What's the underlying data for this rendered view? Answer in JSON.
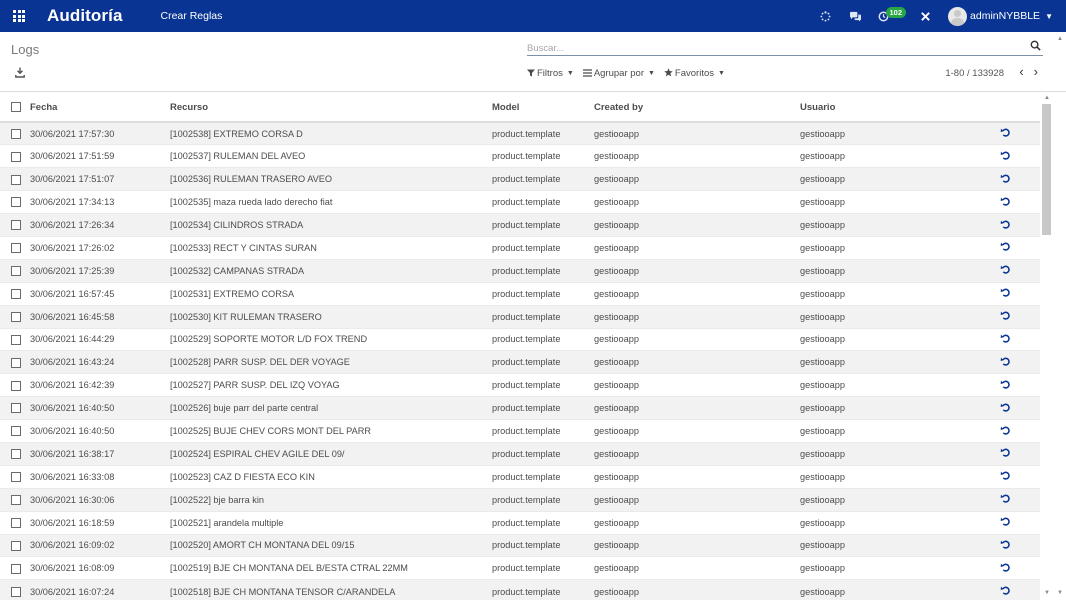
{
  "colors": {
    "navbar": "#0a3493",
    "accent": "#0a3493",
    "badge": "#28a745"
  },
  "navbar": {
    "app_title": "Auditoría",
    "menu_item": "Crear Reglas",
    "icons": [
      "activity-spinner-icon",
      "chat-icon",
      "activity-clock-icon",
      "debug-tools-icon"
    ],
    "badge_count": "102",
    "user": "adminNYBBLE"
  },
  "control_panel": {
    "breadcrumb": "Logs",
    "search_placeholder": "Buscar...",
    "filters_label": "Filtros",
    "group_by_label": "Agrupar por",
    "favorites_label": "Favoritos",
    "pager": "1-80 / 133928"
  },
  "table": {
    "headers": {
      "fecha": "Fecha",
      "recurso": "Recurso",
      "model": "Model",
      "created_by": "Created by",
      "usuario": "Usuario"
    },
    "rows": [
      {
        "fecha": "30/06/2021 17:57:30",
        "recurso": "[1002538] EXTREMO CORSA D",
        "model": "product.template",
        "created_by": "gestiooapp",
        "usuario": "gestiooapp"
      },
      {
        "fecha": "30/06/2021 17:51:59",
        "recurso": "[1002537] RULEMAN DEL AVEO",
        "model": "product.template",
        "created_by": "gestiooapp",
        "usuario": "gestiooapp"
      },
      {
        "fecha": "30/06/2021 17:51:07",
        "recurso": "[1002536] RULEMAN TRASERO AVEO",
        "model": "product.template",
        "created_by": "gestiooapp",
        "usuario": "gestiooapp"
      },
      {
        "fecha": "30/06/2021 17:34:13",
        "recurso": "[1002535] maza rueda lado derecho fiat",
        "model": "product.template",
        "created_by": "gestiooapp",
        "usuario": "gestiooapp"
      },
      {
        "fecha": "30/06/2021 17:26:34",
        "recurso": "[1002534] CILINDROS STRADA",
        "model": "product.template",
        "created_by": "gestiooapp",
        "usuario": "gestiooapp"
      },
      {
        "fecha": "30/06/2021 17:26:02",
        "recurso": "[1002533] RECT Y CINTAS SURAN",
        "model": "product.template",
        "created_by": "gestiooapp",
        "usuario": "gestiooapp"
      },
      {
        "fecha": "30/06/2021 17:25:39",
        "recurso": "[1002532] CAMPANAS STRADA",
        "model": "product.template",
        "created_by": "gestiooapp",
        "usuario": "gestiooapp"
      },
      {
        "fecha": "30/06/2021 16:57:45",
        "recurso": "[1002531] EXTREMO CORSA",
        "model": "product.template",
        "created_by": "gestiooapp",
        "usuario": "gestiooapp"
      },
      {
        "fecha": "30/06/2021 16:45:58",
        "recurso": "[1002530] KIT RULEMAN TRASERO",
        "model": "product.template",
        "created_by": "gestiooapp",
        "usuario": "gestiooapp"
      },
      {
        "fecha": "30/06/2021 16:44:29",
        "recurso": "[1002529] SOPORTE MOTOR L/D FOX TREND",
        "model": "product.template",
        "created_by": "gestiooapp",
        "usuario": "gestiooapp"
      },
      {
        "fecha": "30/06/2021 16:43:24",
        "recurso": "[1002528] PARR SUSP. DEL DER VOYAGE",
        "model": "product.template",
        "created_by": "gestiooapp",
        "usuario": "gestiooapp"
      },
      {
        "fecha": "30/06/2021 16:42:39",
        "recurso": "[1002527] PARR SUSP. DEL IZQ VOYAG",
        "model": "product.template",
        "created_by": "gestiooapp",
        "usuario": "gestiooapp"
      },
      {
        "fecha": "30/06/2021 16:40:50",
        "recurso": "[1002526] buje parr del parte central",
        "model": "product.template",
        "created_by": "gestiooapp",
        "usuario": "gestiooapp"
      },
      {
        "fecha": "30/06/2021 16:40:50",
        "recurso": "[1002525] BUJE CHEV CORS MONT DEL PARR",
        "model": "product.template",
        "created_by": "gestiooapp",
        "usuario": "gestiooapp"
      },
      {
        "fecha": "30/06/2021 16:38:17",
        "recurso": "[1002524] ESPIRAL CHEV AGILE DEL 09/",
        "model": "product.template",
        "created_by": "gestiooapp",
        "usuario": "gestiooapp"
      },
      {
        "fecha": "30/06/2021 16:33:08",
        "recurso": "[1002523] CAZ D FIESTA ECO KIN",
        "model": "product.template",
        "created_by": "gestiooapp",
        "usuario": "gestiooapp"
      },
      {
        "fecha": "30/06/2021 16:30:06",
        "recurso": "[1002522] bje barra kin",
        "model": "product.template",
        "created_by": "gestiooapp",
        "usuario": "gestiooapp"
      },
      {
        "fecha": "30/06/2021 16:18:59",
        "recurso": "[1002521] arandela multiple",
        "model": "product.template",
        "created_by": "gestiooapp",
        "usuario": "gestiooapp"
      },
      {
        "fecha": "30/06/2021 16:09:02",
        "recurso": "[1002520] AMORT CH MONTANA DEL 09/15",
        "model": "product.template",
        "created_by": "gestiooapp",
        "usuario": "gestiooapp"
      },
      {
        "fecha": "30/06/2021 16:08:09",
        "recurso": "[1002519] BJE CH MONTANA DEL B/ESTA CTRAL 22MM",
        "model": "product.template",
        "created_by": "gestiooapp",
        "usuario": "gestiooapp"
      },
      {
        "fecha": "30/06/2021 16:07:24",
        "recurso": "[1002518] BJE CH MONTANA TENSOR C/ARANDELA",
        "model": "product.template",
        "created_by": "gestiooapp",
        "usuario": "gestiooapp"
      }
    ]
  }
}
